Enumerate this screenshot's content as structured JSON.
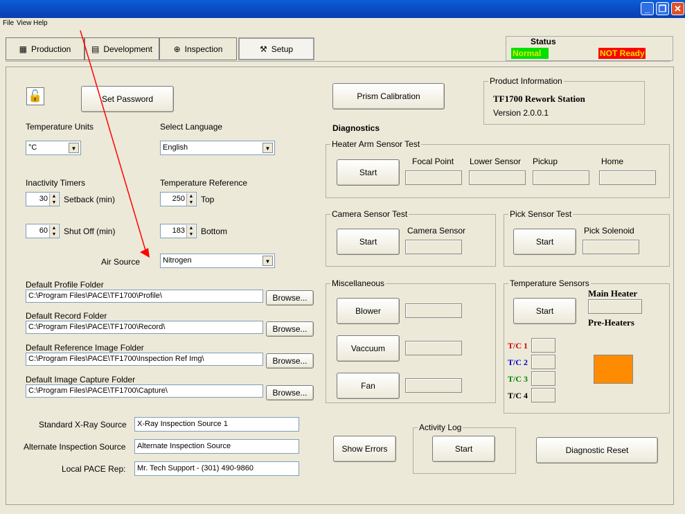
{
  "menu": {
    "file": "File",
    "view": "View",
    "help": "Help"
  },
  "tabs": [
    {
      "label": "Production",
      "icon": "production-icon"
    },
    {
      "label": "Development",
      "icon": "development-icon"
    },
    {
      "label": "Inspection",
      "icon": "inspection-icon"
    },
    {
      "label": "Setup",
      "icon": "setup-icon",
      "active": true
    }
  ],
  "status": {
    "title": "Status",
    "normal": "Normal",
    "not_ready": "NOT Ready",
    "colors": {
      "normal": "#00e000",
      "not_ready": "#ff0000",
      "text": "#e8e800"
    }
  },
  "setup": {
    "set_password": "Set Password",
    "temperature_units_label": "Temperature Units",
    "temperature_units_value": "°C",
    "select_language_label": "Select Language",
    "language_value": "English",
    "inactivity_timers_label": "Inactivity Timers",
    "setback_value": "30",
    "setback_label": "Setback (min)",
    "shutoff_value": "60",
    "shutoff_label": "Shut Off (min)",
    "temperature_reference_label": "Temperature Reference",
    "top_value": "250",
    "top_label": "Top",
    "bottom_value": "183",
    "bottom_label": "Bottom",
    "air_source_label": "Air Source",
    "air_source_value": "Nitrogen",
    "browse_label": "Browse...",
    "folders": [
      {
        "label": "Default Profile Folder",
        "path": "C:\\Program Files\\PACE\\TF1700\\Profile\\"
      },
      {
        "label": "Default Record Folder",
        "path": "C:\\Program Files\\PACE\\TF1700\\Record\\"
      },
      {
        "label": "Default Reference Image Folder",
        "path": "C:\\Program Files\\PACE\\TF1700\\Inspection Ref Img\\"
      },
      {
        "label": "Default Image Capture Folder",
        "path": "C:\\Program Files\\PACE\\TF1700\\Capture\\"
      }
    ],
    "standard_xray_label": "Standard X-Ray Source",
    "standard_xray_value": "X-Ray Inspection Source 1",
    "alternate_inspection_label": "Alternate Inspection Source",
    "alternate_inspection_value": "Alternate Inspection Source",
    "local_rep_label": "Local PACE Rep:",
    "local_rep_value": "Mr. Tech Support - (301) 490-9860"
  },
  "right": {
    "prism_calibration": "Prism Calibration",
    "product_info_title": "Product Information",
    "product_name": "TF1700 Rework Station",
    "version": "Version 2.0.0.1",
    "diagnostics": "Diagnostics",
    "start": "Start",
    "heater_arm_title": "Heater Arm Sensor Test",
    "heater_arm_labels": [
      "Focal Point",
      "Lower Sensor",
      "Pickup",
      "Home"
    ],
    "camera_title": "Camera Sensor Test",
    "camera_sensor_label": "Camera Sensor",
    "pick_title": "Pick Sensor Test",
    "pick_solenoid_label": "Pick Solenoid",
    "misc_title": "Miscellaneous",
    "blower": "Blower",
    "vaccuum": "Vaccuum",
    "fan": "Fan",
    "temp_sensors_title": "Temperature Sensors",
    "main_heater": "Main Heater",
    "pre_heaters": "Pre-Heaters",
    "tc": [
      {
        "label": "T/C 1",
        "color": "#d00000"
      },
      {
        "label": "T/C 2",
        "color": "#0000c0"
      },
      {
        "label": "T/C 3",
        "color": "#008000"
      },
      {
        "label": "T/C 4",
        "color": "#000000"
      }
    ],
    "preheater_color": "#ff8c00",
    "show_errors": "Show Errors",
    "activity_log_title": "Activity Log",
    "diagnostic_reset": "Diagnostic Reset"
  }
}
